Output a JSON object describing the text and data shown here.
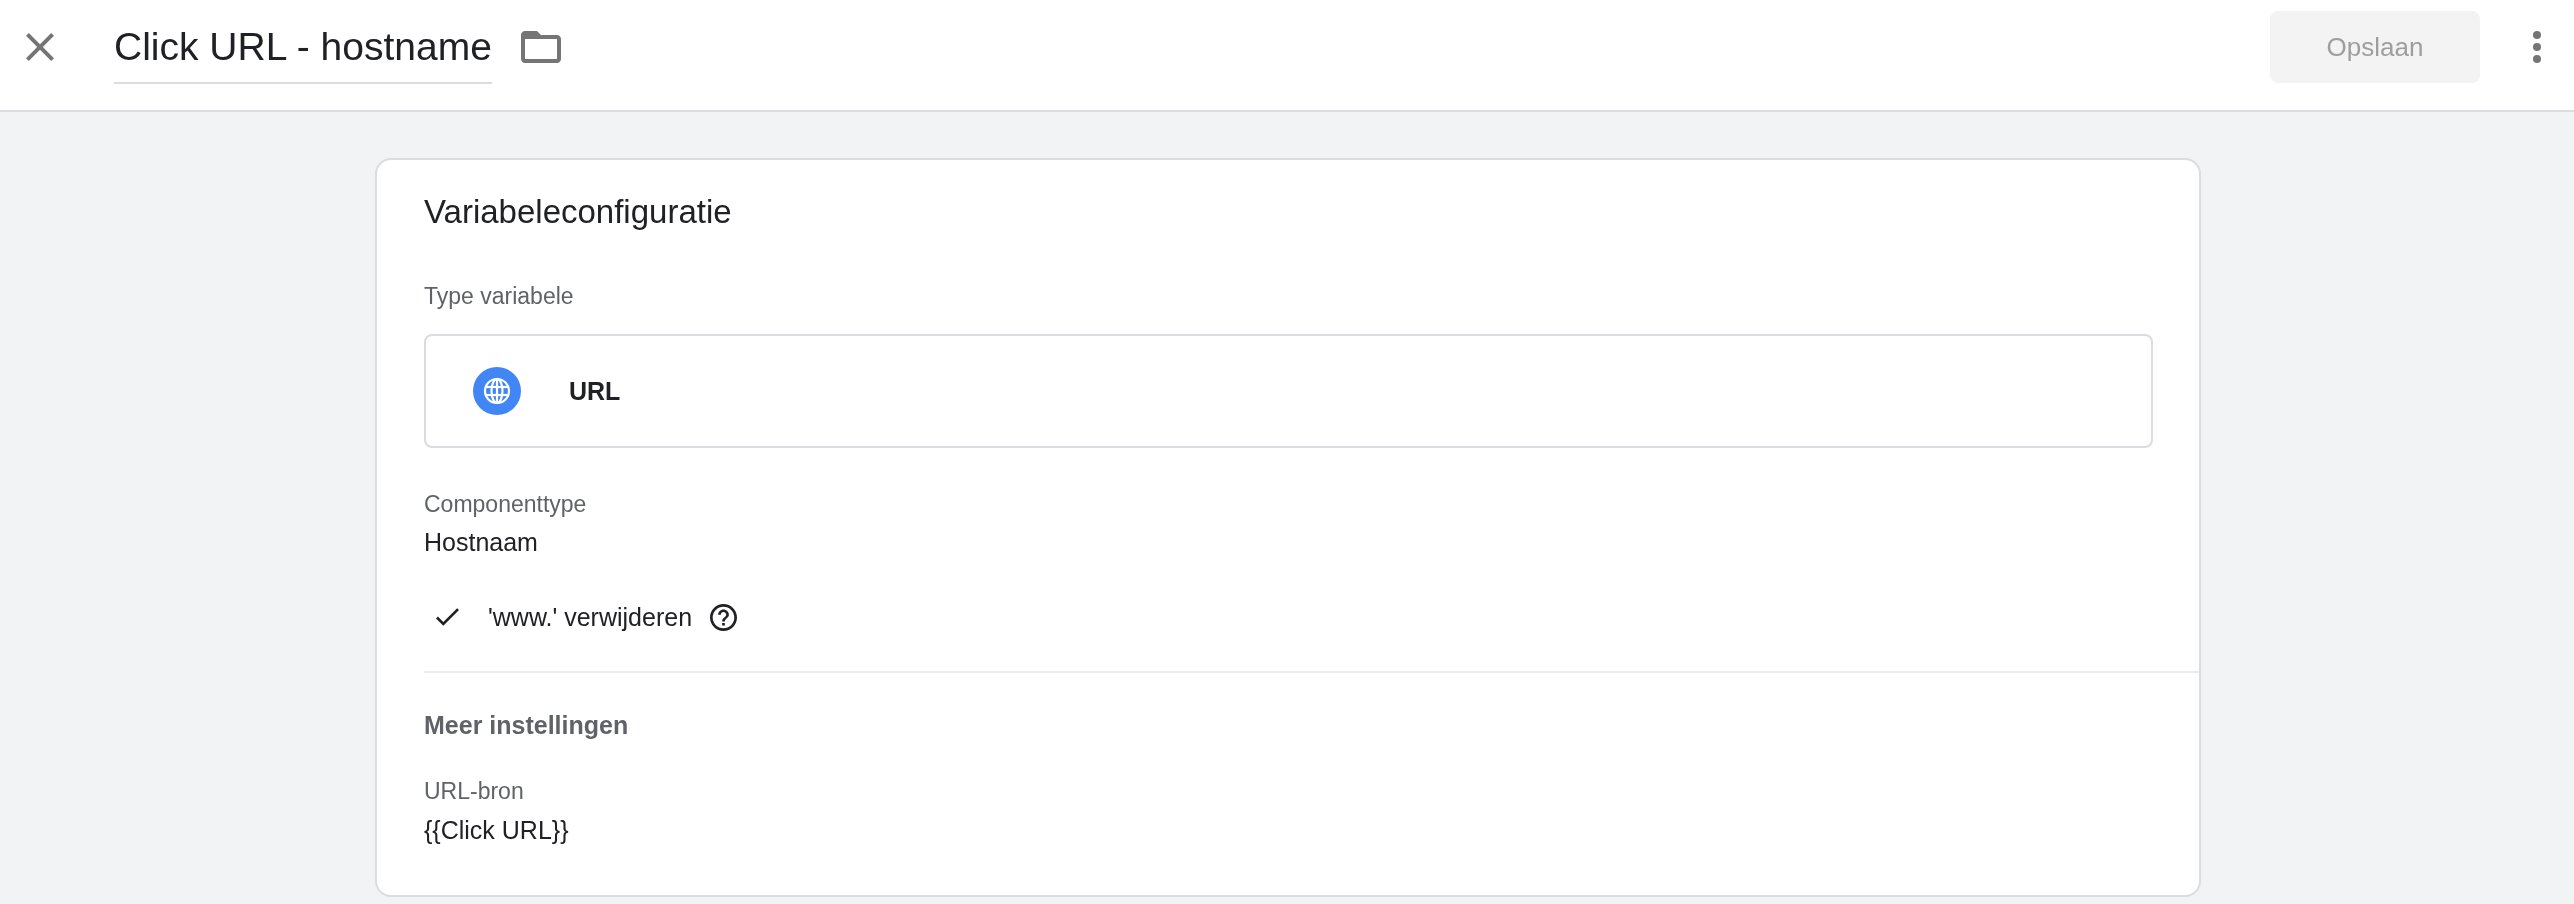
{
  "header": {
    "title": "Click URL - hostname",
    "save_button": {
      "label": "Opslaan",
      "disabled": true
    }
  },
  "card": {
    "title": "Variabeleconfiguratie",
    "variable_type": {
      "label": "Type variabele",
      "name": "URL"
    },
    "component_type": {
      "label": "Componenttype",
      "value": "Hostnaam"
    },
    "options": [
      {
        "label": "'www.' verwijderen",
        "checked": true
      }
    ],
    "more_settings": {
      "title": "Meer instellingen",
      "fields": [
        {
          "label": "URL-bron",
          "value": "{{Click URL}}"
        }
      ]
    }
  }
}
